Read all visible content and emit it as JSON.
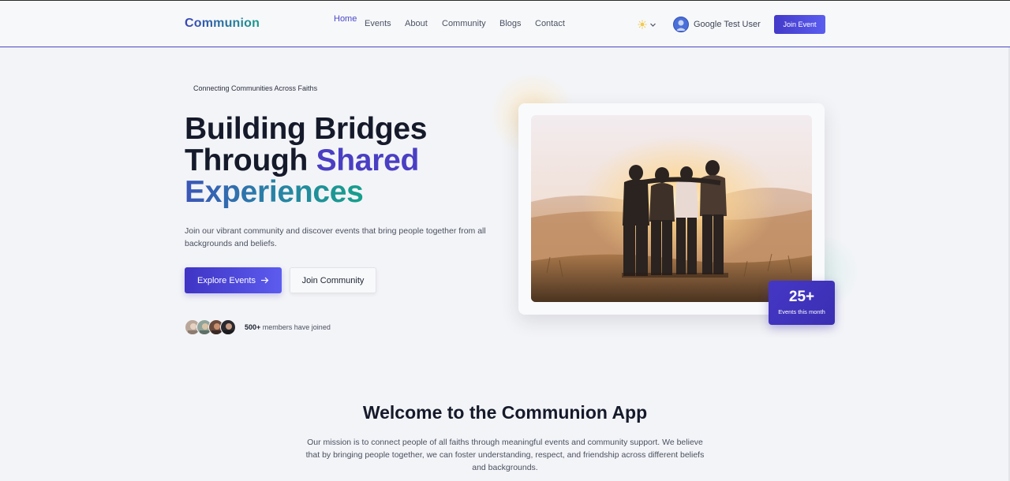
{
  "header": {
    "logo": "Communion",
    "nav": [
      "Home",
      "Events",
      "About",
      "Community",
      "Blogs",
      "Contact"
    ],
    "active_nav": "Home",
    "theme_icon": "sun-icon",
    "user_name": "Google Test User",
    "join_button": "Join Event"
  },
  "hero": {
    "tagline": "Connecting Communities Across Faiths",
    "title_line1": "Building Bridges",
    "title_line2_a": "Through ",
    "title_line2_b": "Shared",
    "title_line3": "Experiences",
    "description": "Join our vibrant community and discover events that bring people together from all backgrounds and beliefs.",
    "explore_button": "Explore Events",
    "community_button": "Join Community",
    "members_count": "500+",
    "members_text": " members have joined"
  },
  "badge": {
    "value": "25+",
    "label": "Events this month"
  },
  "welcome": {
    "title": "Welcome to the Communion App",
    "mission": "Our mission is to connect people of all faiths through meaningful events and community support. We believe that by bringing people together, we can foster understanding, respect, and friendship across different beliefs and backgrounds."
  },
  "colors": {
    "accent": "#4a47c8",
    "teal": "#16a08c",
    "background": "#f3f4f7"
  }
}
